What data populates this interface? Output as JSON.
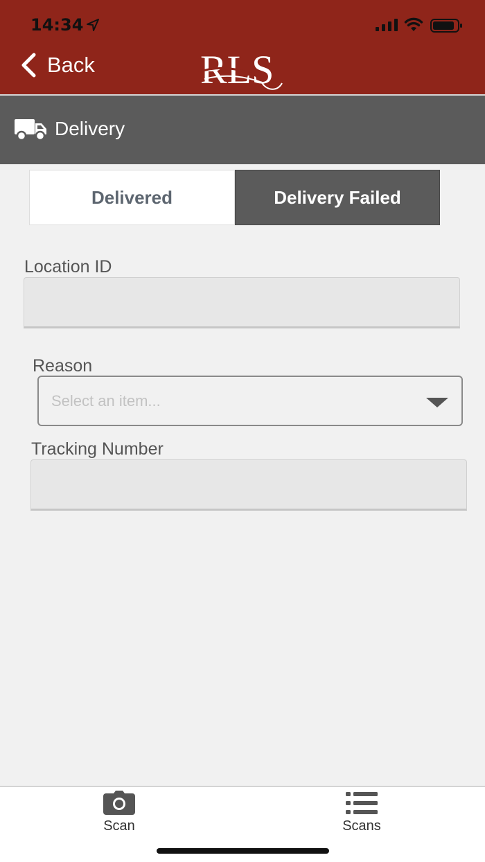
{
  "status_bar": {
    "time": "14:34"
  },
  "nav": {
    "back_label": "Back",
    "logo_text": "RLS"
  },
  "section": {
    "title": "Delivery"
  },
  "segments": [
    {
      "label": "Delivered",
      "selected": false
    },
    {
      "label": "Delivery Failed",
      "selected": true
    }
  ],
  "form": {
    "location_label": "Location ID",
    "location_value": "",
    "reason_label": "Reason",
    "reason_placeholder": "Select an item...",
    "tracking_label": "Tracking Number",
    "tracking_value": ""
  },
  "tabs": [
    {
      "label": "Scan",
      "icon": "camera-icon"
    },
    {
      "label": "Scans",
      "icon": "list-icon"
    }
  ],
  "colors": {
    "nav_red": "#8f251a",
    "section_gray": "#5b5b5b",
    "background": "#f1f1f1"
  }
}
